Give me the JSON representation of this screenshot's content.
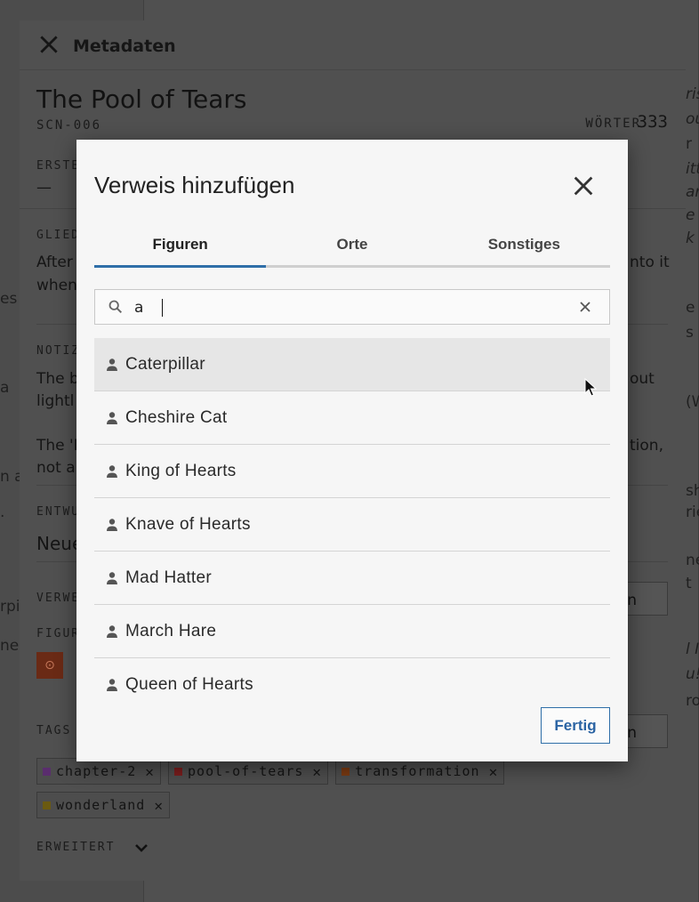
{
  "metadata_panel": {
    "title": "Metadaten",
    "scene_title": "The Pool of Tears",
    "scene_id": "SCN-006",
    "words_label": "WÖRTER",
    "words_value": "333",
    "labels": {
      "created": "ERSTE",
      "created_value": "—",
      "outline": "GLIED",
      "notes": "NOTIZ",
      "drafts": "ENTWU",
      "references": "VERWE",
      "characters": "FIGUR",
      "tags": "TAGS",
      "advanced": "ERWEITERT"
    },
    "texts": {
      "outline_line1": "After",
      "outline_line2": "when",
      "notes_line1": "The b",
      "notes_line2": "lightl",
      "notes_line3": "The 'H",
      "notes_line4": "not a",
      "drafts_value": "Neue",
      "outline_right1": "nto it",
      "notes_right1": "out",
      "notes_right2": "tion,",
      "btn_fragment1": "gen",
      "btn_fragment2": "gen"
    },
    "tags": [
      {
        "label": "chapter-2",
        "color": "#5a2d6e"
      },
      {
        "label": "pool-of-tears",
        "color": "#7a1d1d"
      },
      {
        "label": "transformation",
        "color": "#7a3a12"
      },
      {
        "label": "wonderland",
        "color": "#6b5a10"
      }
    ],
    "tag_remove_glyph": "✕"
  },
  "background": {
    "left_fragments": [
      "es",
      "a",
      "n a",
      ".",
      "rpi",
      "ne"
    ],
    "right_fragments": [
      "ris",
      "ou",
      "r",
      "itt",
      "an",
      "e",
      "k",
      "e i",
      "s",
      "(W",
      "sh",
      "rie",
      "ne",
      "t",
      "l I",
      "u!",
      "ro"
    ]
  },
  "dialog": {
    "title": "Verweis hinzufügen",
    "tabs": [
      {
        "label": "Figuren",
        "active": true
      },
      {
        "label": "Orte",
        "active": false
      },
      {
        "label": "Sonstiges",
        "active": false
      }
    ],
    "search": {
      "value": "a",
      "placeholder": ""
    },
    "results": [
      {
        "label": "Caterpillar",
        "hover": true
      },
      {
        "label": "Cheshire Cat"
      },
      {
        "label": "King of Hearts"
      },
      {
        "label": "Knave of Hearts"
      },
      {
        "label": "Mad Hatter"
      },
      {
        "label": "March Hare"
      },
      {
        "label": "Queen of Hearts"
      }
    ],
    "done_label": "Fertig"
  }
}
